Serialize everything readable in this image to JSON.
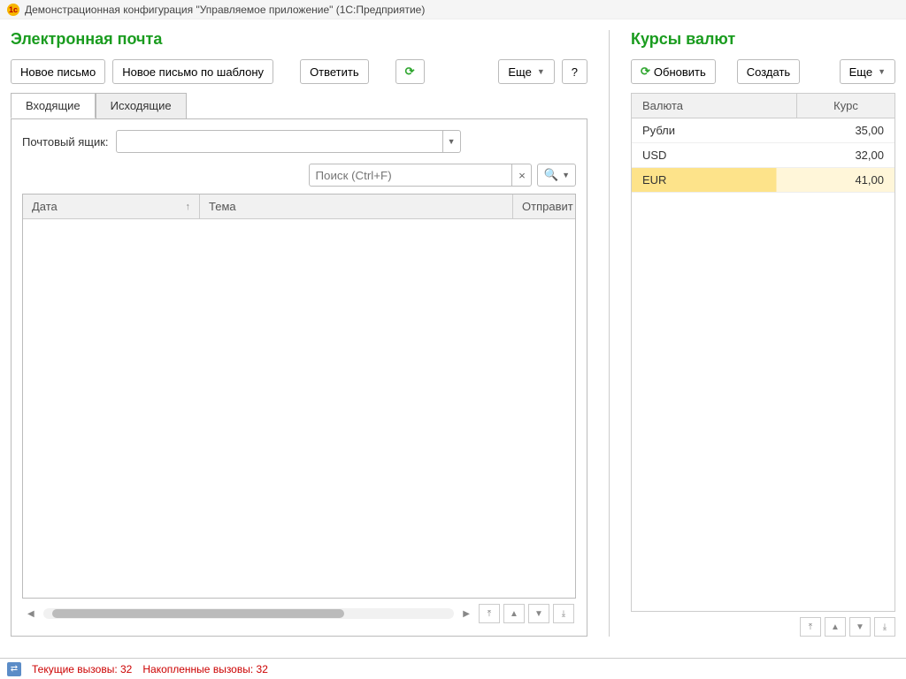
{
  "window": {
    "title": "Демонстрационная конфигурация \"Управляемое приложение\"  (1С:Предприятие)"
  },
  "email": {
    "title": "Электронная почта",
    "toolbar": {
      "new": "Новое письмо",
      "new_template": "Новое письмо по шаблону",
      "reply": "Ответить",
      "more": "Еще",
      "help": "?"
    },
    "tabs": {
      "inbox": "Входящие",
      "outbox": "Исходящие"
    },
    "mailbox_label": "Почтовый ящик:",
    "search_placeholder": "Поиск (Ctrl+F)",
    "columns": {
      "date": "Дата",
      "subject": "Тема",
      "from": "Отправит"
    }
  },
  "rates": {
    "title": "Курсы валют",
    "toolbar": {
      "refresh": "Обновить",
      "create": "Создать",
      "more": "Еще"
    },
    "columns": {
      "currency": "Валюта",
      "rate": "Курс"
    },
    "rows": [
      {
        "currency": "Рубли",
        "rate": "35,00",
        "selected": false
      },
      {
        "currency": "USD",
        "rate": "32,00",
        "selected": false
      },
      {
        "currency": "EUR",
        "rate": "41,00",
        "selected": true
      }
    ]
  },
  "status": {
    "current": "Текущие вызовы: 32",
    "accumulated": "Накопленные вызовы: 32"
  }
}
